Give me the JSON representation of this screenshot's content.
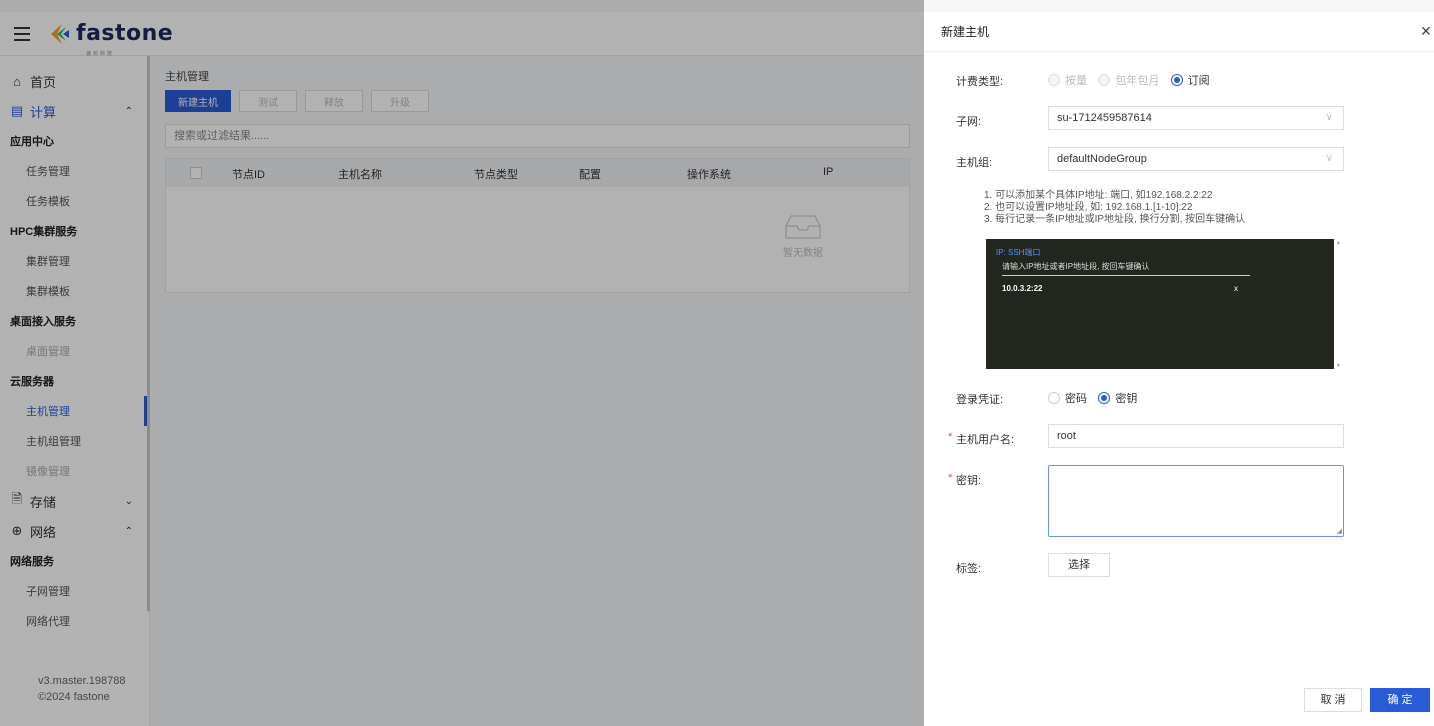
{
  "logo": {
    "text": "fastone",
    "sub": "速石科技"
  },
  "sidebar": {
    "home": "首页",
    "compute": "计算",
    "app_center": "应用中心",
    "task_mgmt": "任务管理",
    "task_tpl": "任务模板",
    "hpc": "HPC集群服务",
    "cluster_mgmt": "集群管理",
    "cluster_tpl": "集群模板",
    "desktop": "桌面接入服务",
    "desktop_mgmt": "桌面管理",
    "cloud_server": "云服务器",
    "host_mgmt": "主机管理",
    "host_group_mgmt": "主机组管理",
    "image_mgmt": "镜像管理",
    "storage": "存储",
    "network": "网络",
    "network_service": "网络服务",
    "subnet_mgmt": "子网管理",
    "network_proxy": "网络代理",
    "version": "v3.master.198788",
    "copyright": "©2024 fastone"
  },
  "main": {
    "breadcrumb": "主机管理",
    "buttons": {
      "new_host": "新建主机",
      "test": "测试",
      "release": "释放",
      "upgrade": "升级"
    },
    "search_placeholder": "搜索或过滤结果......",
    "columns": {
      "node_id": "节点ID",
      "host_name": "主机名称",
      "node_type": "节点类型",
      "config": "配置",
      "os": "操作系统",
      "ip": "IP"
    },
    "empty": "暂无数据"
  },
  "drawer": {
    "title": "新建主机",
    "billing": {
      "label": "计费类型:",
      "options": [
        "按量",
        "包年包月",
        "订阅"
      ],
      "selected": "订阅"
    },
    "subnet": {
      "label": "子网:",
      "value": "su-1712459587614"
    },
    "host_group": {
      "label": "主机组:",
      "value": "defaultNodeGroup"
    },
    "hints": [
      "1. 可以添加某个具体IP地址: 端口, 如192.168.2.2:22",
      "2. 也可以设置IP地址段, 如: 192.168.1.[1-10]:22",
      "3. 每行记录一条IP地址或IP地址段, 换行分割, 按回车键确认"
    ],
    "terminal": {
      "title": "IP: SSH端口",
      "placeholder": "请输入IP地址或者IP地址段, 按回车键确认",
      "entry": "10.0.3.2:22",
      "remove": "x"
    },
    "credential": {
      "label": "登录凭证:",
      "options": [
        "密码",
        "密钥"
      ],
      "selected": "密钥"
    },
    "username": {
      "label": "主机用户名:",
      "value": "root",
      "required": "*"
    },
    "key": {
      "label": "密钥:",
      "value": "",
      "required": "*"
    },
    "tags": {
      "label": "标签:",
      "button": "选择"
    },
    "footer": {
      "cancel": "取 消",
      "ok": "确 定"
    }
  },
  "colors": {
    "primary": "#2a5bd7",
    "required": "#e5484d",
    "terminal_bg": "#22271f"
  }
}
